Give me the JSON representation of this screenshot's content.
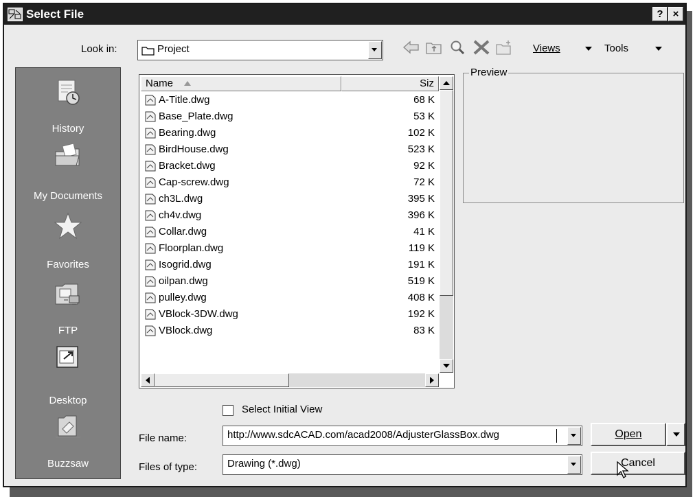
{
  "window": {
    "title": "Select File",
    "help_label": "?",
    "close_label": "×"
  },
  "look_in": {
    "label": "Look in:",
    "value": "Project"
  },
  "toolbar": {
    "views_label": "Views",
    "tools_label": "Tools",
    "icons": [
      "back-arrow-icon",
      "up-folder-icon",
      "search-web-icon",
      "delete-icon",
      "create-folder-icon"
    ]
  },
  "places": [
    {
      "label": "History",
      "icon": "history-icon"
    },
    {
      "label": "My Documents",
      "icon": "my-documents-icon"
    },
    {
      "label": "Favorites",
      "icon": "favorites-star-icon"
    },
    {
      "label": "FTP",
      "icon": "ftp-icon"
    },
    {
      "label": "Desktop",
      "icon": "desktop-icon"
    },
    {
      "label": "Buzzsaw",
      "icon": "buzzsaw-icon"
    }
  ],
  "file_list": {
    "columns": {
      "name": "Name",
      "size": "Siz"
    },
    "files": [
      {
        "name": "A-Title.dwg",
        "size": "68 K"
      },
      {
        "name": "Base_Plate.dwg",
        "size": "53 K"
      },
      {
        "name": "Bearing.dwg",
        "size": "102 K"
      },
      {
        "name": "BirdHouse.dwg",
        "size": "523 K"
      },
      {
        "name": "Bracket.dwg",
        "size": "92 K"
      },
      {
        "name": "Cap-screw.dwg",
        "size": "72 K"
      },
      {
        "name": "ch3L.dwg",
        "size": "395 K"
      },
      {
        "name": "ch4v.dwg",
        "size": "396 K"
      },
      {
        "name": "Collar.dwg",
        "size": "41 K"
      },
      {
        "name": "Floorplan.dwg",
        "size": "119 K"
      },
      {
        "name": "Isogrid.dwg",
        "size": "191 K"
      },
      {
        "name": "oilpan.dwg",
        "size": "519 K"
      },
      {
        "name": "pulley.dwg",
        "size": "408 K"
      },
      {
        "name": "VBlock-3DW.dwg",
        "size": "192 K"
      },
      {
        "name": "VBlock.dwg",
        "size": "83 K"
      }
    ]
  },
  "preview": {
    "label": "Preview"
  },
  "select_initial_view": {
    "label": "Select Initial View",
    "checked": false
  },
  "file_name": {
    "label": "File name:",
    "value": "http://www.sdcACAD.com/acad2008/AdjusterGlassBox.dwg"
  },
  "files_of_type": {
    "label": "Files of type:",
    "value": "Drawing (*.dwg)"
  },
  "buttons": {
    "open": "Open",
    "cancel": "Cancel"
  }
}
